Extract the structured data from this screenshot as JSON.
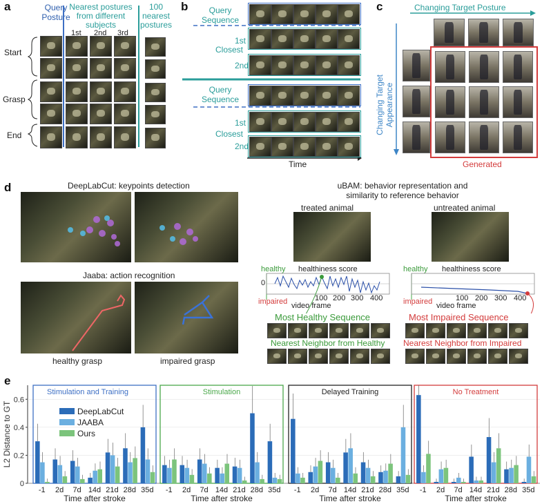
{
  "panels": {
    "a": "a",
    "b": "b",
    "c": "c",
    "d": "d",
    "e": "e"
  },
  "panel_a": {
    "col_query": "Query Posture",
    "col_nearest": "Nearest postures from different subjects",
    "col_100": "100 nearest postures",
    "ranks": [
      "1st",
      "2nd",
      "3rd"
    ],
    "rows": [
      "Start",
      "Grasp",
      "End"
    ]
  },
  "panel_b": {
    "query1": "Query Sequence",
    "closest1": "Closest",
    "query2": "Query Sequence",
    "closest2": "Closest",
    "ranks": [
      "1st",
      "2nd"
    ],
    "time": "Time"
  },
  "panel_c": {
    "top": "Changing Target Posture",
    "left": "Changing Target Appearance",
    "generated": "Generated"
  },
  "panel_d": {
    "dlc_title": "DeepLabCut: keypoints detection",
    "jaaba_title": "Jaaba: action recognition",
    "healthy_grasp": "healthy grasp",
    "impaired_grasp": "impaired grasp",
    "ubam_title": "uBAM: behavior representation and similarity to reference behavior",
    "treated": "treated animal",
    "untreated": "untreated animal",
    "healthy": "healthy",
    "impaired": "impaired",
    "score": "healthiness score",
    "video_frame": "video frame",
    "zero": "0",
    "ticks": [
      "100",
      "200",
      "300",
      "400"
    ],
    "most_healthy": "Most Healthy Sequence",
    "most_impaired": "Most Impaired Sequence",
    "nn_healthy": "Nearest Neighbor from Healthy",
    "nn_impaired": "Nearest Neighbor from Impaired"
  },
  "chart_data": {
    "type": "bar",
    "ylabel": "L2 Distance to GT",
    "xlabel": "Time after stroke",
    "ylim": [
      0,
      0.7
    ],
    "yticks": [
      "0",
      "0.2",
      "0.4",
      "0.6"
    ],
    "categories": [
      "-1",
      "2d",
      "7d",
      "14d",
      "21d",
      "28d",
      "35d"
    ],
    "legend": [
      "DeepLabCut",
      "JAABA",
      "Ours"
    ],
    "colors": {
      "DeepLabCut": "#2b6cb8",
      "JAABA": "#6bafe0",
      "Ours": "#7cc47c"
    },
    "groups": [
      {
        "title": "Stimulation and Training",
        "border": "#3d6fc4",
        "title_color": "#3d6fc4",
        "series": [
          {
            "name": "DeepLabCut",
            "values": [
              0.3,
              0.17,
              0.16,
              0.04,
              0.22,
              0.25,
              0.4
            ]
          },
          {
            "name": "JAABA",
            "values": [
              0.15,
              0.13,
              0.12,
              0.09,
              0.2,
              0.15,
              0.17
            ]
          },
          {
            "name": "Ours",
            "values": [
              0.01,
              0.05,
              0.03,
              0.1,
              0.12,
              0.18,
              0.08
            ]
          }
        ]
      },
      {
        "title": "Stimulation",
        "border": "#4aa84a",
        "title_color": "#4aa84a",
        "series": [
          {
            "name": "DeepLabCut",
            "values": [
              0.13,
              0.13,
              0.17,
              0.11,
              0.12,
              0.5,
              0.3
            ]
          },
          {
            "name": "JAABA",
            "values": [
              0.11,
              0.11,
              0.14,
              0.07,
              0.11,
              0.15,
              0.04
            ]
          },
          {
            "name": "Ours",
            "values": [
              0.17,
              0.06,
              0.07,
              0.14,
              0.02,
              0.03,
              0.03
            ]
          }
        ]
      },
      {
        "title": "Delayed Training",
        "border": "#222222",
        "title_color": "#222222",
        "series": [
          {
            "name": "DeepLabCut",
            "values": [
              0.46,
              0.08,
              0.15,
              0.22,
              0.15,
              0.08,
              0.05
            ]
          },
          {
            "name": "JAABA",
            "values": [
              0.07,
              0.12,
              0.11,
              0.25,
              0.11,
              0.09,
              0.4
            ]
          },
          {
            "name": "Ours",
            "values": [
              0.04,
              0.16,
              0.04,
              0.07,
              0.05,
              0.14,
              0.06
            ]
          }
        ]
      },
      {
        "title": "No Treatment",
        "border": "#d33b3b",
        "title_color": "#d33b3b",
        "series": [
          {
            "name": "DeepLabCut",
            "values": [
              0.63,
              0.01,
              0.01,
              0.19,
              0.33,
              0.1,
              0.01
            ]
          },
          {
            "name": "JAABA",
            "values": [
              0.08,
              0.1,
              0.04,
              0.02,
              0.15,
              0.11,
              0.19
            ]
          },
          {
            "name": "Ours",
            "values": [
              0.21,
              0.11,
              0.01,
              0.02,
              0.25,
              0.13,
              0.05
            ]
          }
        ]
      }
    ]
  }
}
